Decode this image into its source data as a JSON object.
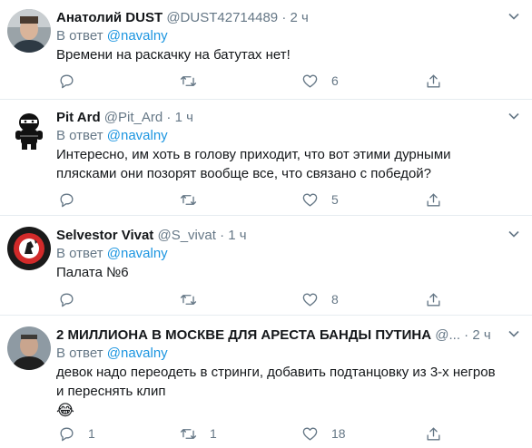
{
  "tweets": [
    {
      "name": "Анатолий DUST",
      "handle": "@DUST42714489",
      "dot": "·",
      "time": "2 ч",
      "reply_prefix": "В ответ",
      "reply_to": "@navalny",
      "text": "Времени на раскачку на батутах нет!",
      "replies": "",
      "retweets": "",
      "likes": "6"
    },
    {
      "name": "Pit Ard",
      "handle": "@Pit_Ard",
      "dot": "·",
      "time": "1 ч",
      "reply_prefix": "В ответ",
      "reply_to": "@navalny",
      "text": "Интересно, им хоть в голову приходит, что вот этими дурными плясками они позорят вообще все, что связано с победой?",
      "replies": "",
      "retweets": "",
      "likes": "5"
    },
    {
      "name": "Selvestor Vivat",
      "handle": "@S_vivat",
      "dot": "·",
      "time": "1 ч",
      "reply_prefix": "В ответ",
      "reply_to": "@navalny",
      "text": "Палата №6",
      "replies": "",
      "retweets": "",
      "likes": "8"
    },
    {
      "name": "2 МИЛЛИОНА В МОСКВЕ ДЛЯ АРЕСТА БАНДЫ ПУТИНА",
      "handle": "@...",
      "dot": "·",
      "time": "2 ч",
      "reply_prefix": "В ответ",
      "reply_to": "@navalny",
      "text": "девок надо переодеть в стринги, добавить подтанцовку из 3-х негров и переснять клип",
      "emoji": "😂",
      "replies": "1",
      "retweets": "1",
      "likes": "18"
    }
  ]
}
